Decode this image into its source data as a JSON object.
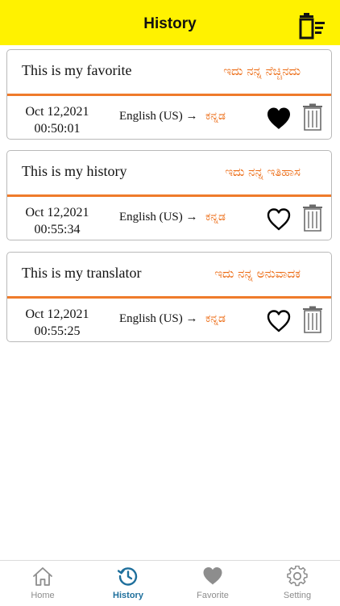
{
  "header": {
    "title": "History",
    "clear_icon": "clear-list-icon"
  },
  "colors": {
    "header_bg": "#fff200",
    "accent": "#ec6a12",
    "active_tab": "#1e6f9c"
  },
  "history": [
    {
      "source_text": "This is my favorite",
      "translated_text": "ಇದು ನನ್ನ ನೆಚ್ಚಿನದು",
      "date": "Oct 12,2021",
      "time": "00:50:01",
      "from_lang": "English (US) →",
      "to_lang": "ಕನ್ನಡ",
      "favorited": true
    },
    {
      "source_text": "This is my history",
      "translated_text": "ಇದು ನನ್ನ ಇತಿಹಾಸ",
      "date": "Oct 12,2021",
      "time": "00:55:34",
      "from_lang": "English (US) →",
      "to_lang": "ಕನ್ನಡ",
      "favorited": false
    },
    {
      "source_text": "This is my translator",
      "translated_text": "ಇದು ನನ್ನ ಅನುವಾದಕ",
      "date": "Oct 12,2021",
      "time": "00:55:25",
      "from_lang": "English (US) →",
      "to_lang": "ಕನ್ನಡ",
      "favorited": false
    }
  ],
  "tabs": [
    {
      "label": "Home",
      "icon": "home-icon"
    },
    {
      "label": "History",
      "icon": "history-icon",
      "active": true
    },
    {
      "label": "Favorite",
      "icon": "heart-icon"
    },
    {
      "label": "Setting",
      "icon": "gear-icon"
    }
  ]
}
